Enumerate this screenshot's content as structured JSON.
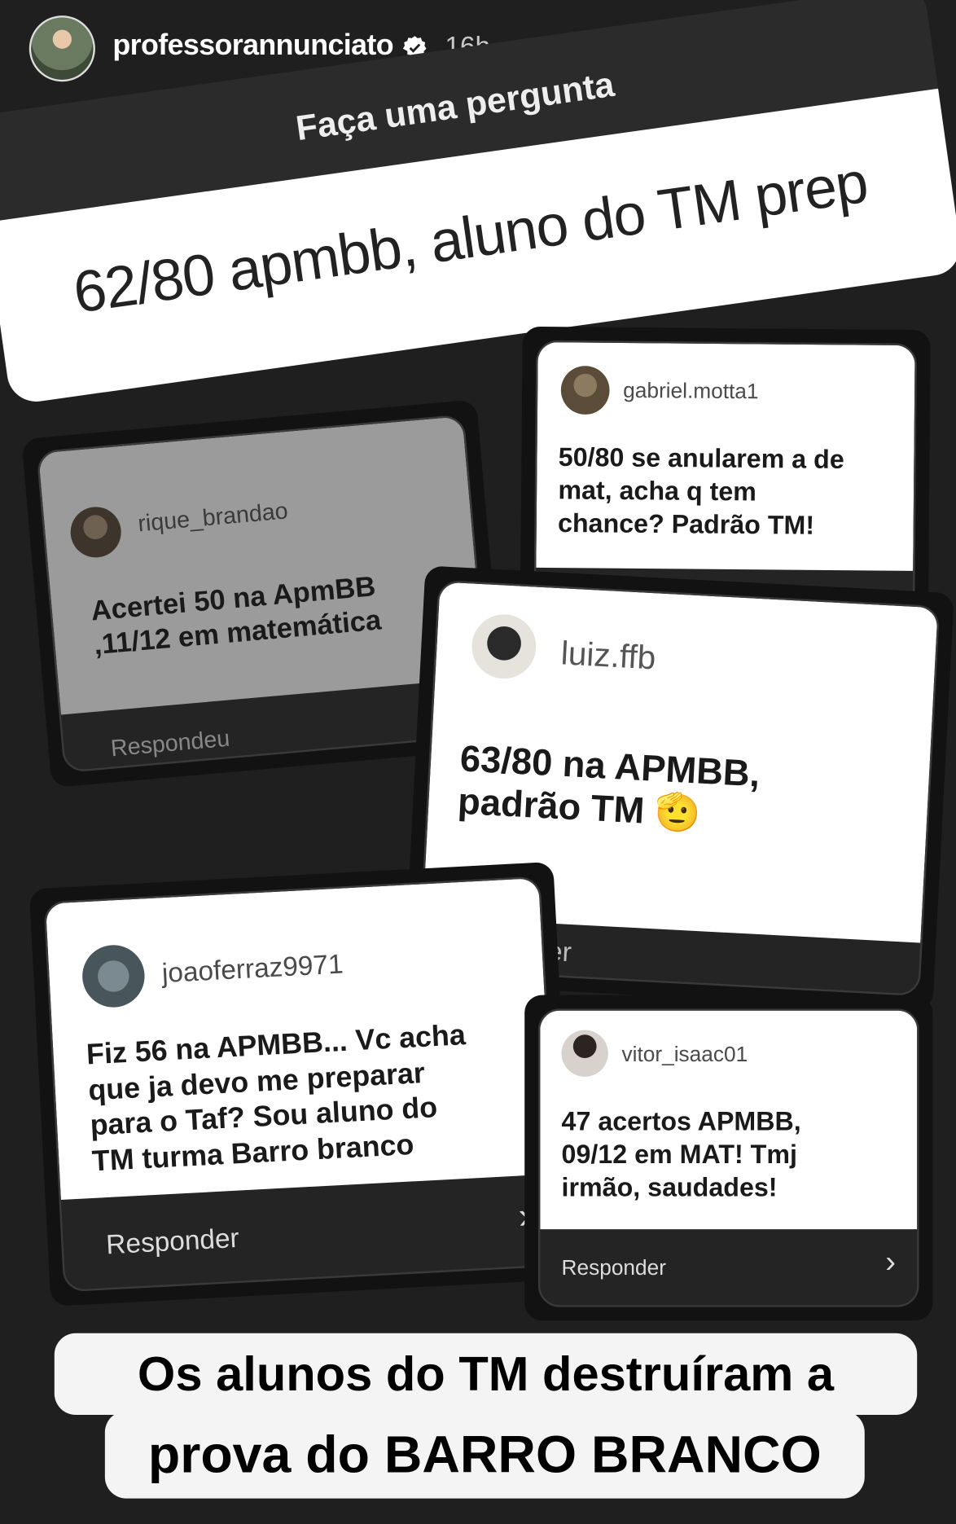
{
  "header": {
    "username": "professorannunciato",
    "time": "16h"
  },
  "question_sticker": {
    "title": "Faça uma pergunta",
    "answer": "62/80 apmbb, aluno do TM prep"
  },
  "replies": [
    {
      "username": "rique_brandao",
      "message_lines": [
        "Acertei 50 na ApmBB",
        ",11/12 em matemática"
      ],
      "footer": "Respondeu"
    },
    {
      "username": "gabriel.motta1",
      "message_lines": [
        "50/80 se anularem a de",
        "mat, acha q tem",
        "chance? Padrão TM!"
      ],
      "footer": ""
    },
    {
      "username": "luiz.ffb",
      "message_lines": [
        "63/80 na APMBB,",
        "padrão TM 🫡"
      ],
      "footer": "er"
    },
    {
      "username": "joaoferraz9971",
      "message_lines": [
        "Fiz 56 na APMBB... Vc acha",
        "que ja devo me preparar",
        "para o Taf? Sou aluno do",
        "TM turma Barro branco"
      ],
      "footer": "Responder"
    },
    {
      "username": "vitor_isaac01",
      "message_lines": [
        "47 acertos APMBB,",
        "09/12 em MAT! Tmj",
        "irmão, saudades!"
      ],
      "footer": "Responder"
    }
  ],
  "caption": {
    "line1": "Os alunos do TM destruíram a",
    "line2": "prova do BARRO BRANCO"
  },
  "icons": [
    "verified-badge-icon",
    "play-icon",
    "mute-icon",
    "more-options-icon",
    "chevron-right-icon"
  ],
  "colors": {
    "background": "#1f1f1f",
    "card_white": "#ffffff",
    "caption_bg": "#f4f4f4"
  }
}
